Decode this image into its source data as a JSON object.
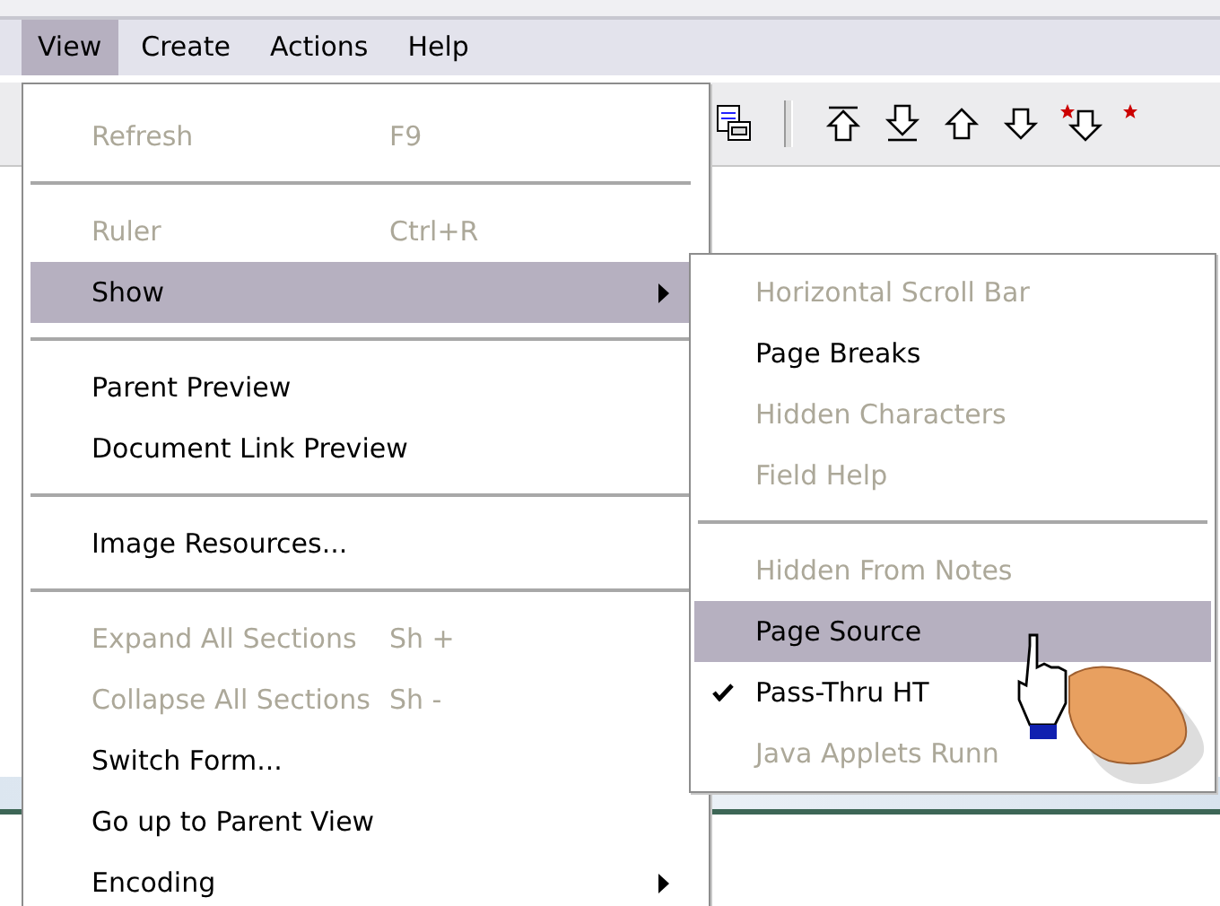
{
  "menubar": [
    {
      "label": "View",
      "selected": true
    },
    {
      "label": "Create",
      "selected": false
    },
    {
      "label": "Actions",
      "selected": false
    },
    {
      "label": "Help",
      "selected": false
    }
  ],
  "view_menu": [
    {
      "kind": "item",
      "label": "Refresh",
      "shortcut": "F9",
      "disabled": true,
      "selected": false,
      "submenu": false
    },
    {
      "kind": "separator"
    },
    {
      "kind": "item",
      "label": "Ruler",
      "shortcut": "Ctrl+R",
      "disabled": true,
      "selected": false,
      "submenu": false
    },
    {
      "kind": "item",
      "label": "Show",
      "disabled": false,
      "selected": true,
      "submenu": true
    },
    {
      "kind": "separator"
    },
    {
      "kind": "item",
      "label": "Parent Preview",
      "disabled": false,
      "selected": false,
      "submenu": false
    },
    {
      "kind": "item",
      "label": "Document Link Preview",
      "disabled": false,
      "selected": false,
      "submenu": false
    },
    {
      "kind": "separator"
    },
    {
      "kind": "item",
      "label": "Image Resources...",
      "disabled": false,
      "selected": false,
      "submenu": false
    },
    {
      "kind": "separator"
    },
    {
      "kind": "item",
      "label": "Expand All Sections",
      "shortcut": "Sh +",
      "disabled": true,
      "selected": false,
      "submenu": false
    },
    {
      "kind": "item",
      "label": "Collapse All Sections",
      "shortcut": "Sh -",
      "disabled": true,
      "selected": false,
      "submenu": false
    },
    {
      "kind": "item",
      "label": "Switch Form...",
      "disabled": false,
      "selected": false,
      "submenu": false
    },
    {
      "kind": "item",
      "label": "Go up to Parent View",
      "disabled": false,
      "selected": false,
      "submenu": false
    },
    {
      "kind": "item",
      "label": "Encoding",
      "disabled": false,
      "selected": false,
      "submenu": true
    }
  ],
  "show_submenu": [
    {
      "kind": "item",
      "label": "Horizontal Scroll Bar",
      "disabled": true,
      "selected": false,
      "checked": false
    },
    {
      "kind": "item",
      "label": "Page Breaks",
      "disabled": false,
      "selected": false,
      "checked": false
    },
    {
      "kind": "item",
      "label": "Hidden Characters",
      "disabled": true,
      "selected": false,
      "checked": false
    },
    {
      "kind": "item",
      "label": "Field Help",
      "disabled": true,
      "selected": false,
      "checked": false
    },
    {
      "kind": "separator"
    },
    {
      "kind": "item",
      "label": "Hidden From Notes",
      "disabled": true,
      "selected": false,
      "checked": false
    },
    {
      "kind": "item",
      "label": "Page Source",
      "disabled": false,
      "selected": true,
      "checked": false
    },
    {
      "kind": "item",
      "label": "Pass-Thru HT",
      "disabled": false,
      "selected": false,
      "checked": true
    },
    {
      "kind": "item",
      "label": "Java Applets Runn",
      "disabled": true,
      "selected": false,
      "checked": false
    }
  ]
}
